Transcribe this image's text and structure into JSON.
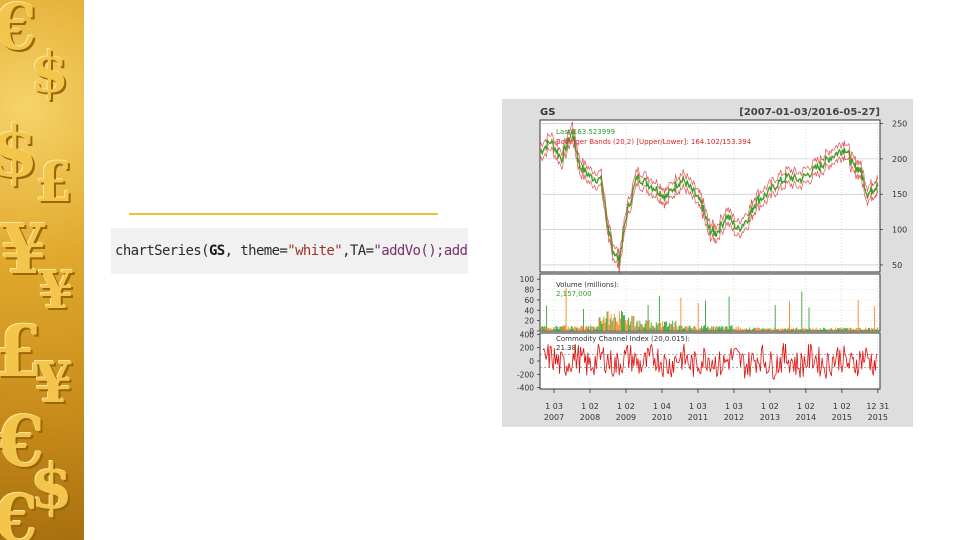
{
  "code": {
    "fn": "chartSeries(",
    "arg": "GS",
    "sep1": ", theme=",
    "theme": "\"white\"",
    "sep2": ",TA=",
    "ta": "\"addVo();addBBands();addCCI()\"",
    "close": ")"
  },
  "chart_data": {
    "type": "line",
    "title": "GS",
    "date_range": "[2007-01-03/2016-05-27]",
    "x_ticks": [
      {
        "top": "1 03",
        "bottom": "2007"
      },
      {
        "top": "1 02",
        "bottom": "2008"
      },
      {
        "top": "1 02",
        "bottom": "2009"
      },
      {
        "top": "1 04",
        "bottom": "2010"
      },
      {
        "top": "1 03",
        "bottom": "2011"
      },
      {
        "top": "1 03",
        "bottom": "2012"
      },
      {
        "top": "1 02",
        "bottom": "2013"
      },
      {
        "top": "1 02",
        "bottom": "2014"
      },
      {
        "top": "1 02",
        "bottom": "2015"
      },
      {
        "top": "12 31",
        "bottom": "2015"
      }
    ],
    "price_panel": {
      "last_label": "Last 163.523999",
      "bbands_label": "Bollinger Bands (20,2) [Upper/Lower]: 164.102/153.394",
      "y_ticks": [
        250,
        200,
        150,
        100,
        50
      ],
      "ylim": [
        40,
        255
      ],
      "x": [
        2007.0,
        2007.3,
        2007.6,
        2007.9,
        2008.1,
        2008.4,
        2008.7,
        2008.9,
        2009.0,
        2009.2,
        2009.4,
        2009.7,
        2010.0,
        2010.3,
        2010.5,
        2010.8,
        2011.0,
        2011.3,
        2011.5,
        2011.7,
        2011.9,
        2012.2,
        2012.5,
        2012.8,
        2013.0,
        2013.3,
        2013.6,
        2013.9,
        2014.2,
        2014.5,
        2014.8,
        2015.0,
        2015.3,
        2015.5,
        2015.7,
        2015.9,
        2016.1,
        2016.3,
        2016.4
      ],
      "close": [
        210,
        225,
        200,
        240,
        190,
        175,
        170,
        100,
        75,
        55,
        120,
        175,
        165,
        155,
        145,
        165,
        170,
        150,
        135,
        100,
        95,
        120,
        100,
        118,
        140,
        150,
        165,
        175,
        170,
        180,
        190,
        200,
        210,
        215,
        190,
        185,
        150,
        160,
        163.5
      ]
    },
    "volume_panel": {
      "label": "Volume (millions):",
      "value": "2,157,000",
      "y_ticks": [
        100,
        80,
        60,
        40,
        20,
        0
      ],
      "ylim": [
        0,
        110
      ]
    },
    "cci_panel": {
      "label": "Commodity Channel Index (20,0.015):",
      "value": "21.38",
      "y_ticks": [
        400,
        200,
        0,
        -200,
        -400
      ],
      "ylim": [
        -420,
        420
      ]
    }
  }
}
